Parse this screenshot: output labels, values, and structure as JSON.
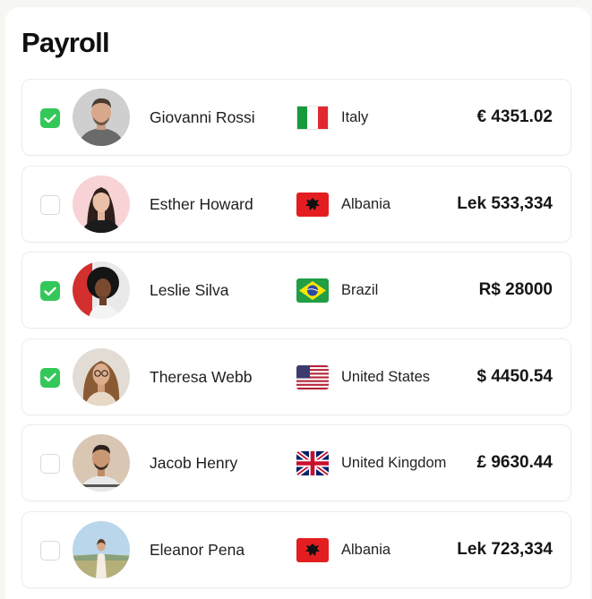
{
  "title": "Payroll",
  "colors": {
    "accent_check": "#34c759",
    "card_border": "#ececec",
    "page_background": "#f6f6f3"
  },
  "employees": [
    {
      "name": "Giovanni Rossi",
      "country": "Italy",
      "flag": "italy-flag-icon",
      "amount": "€ 4351.02",
      "checked": true
    },
    {
      "name": "Esther Howard",
      "country": "Albania",
      "flag": "albania-flag-icon",
      "amount": "Lek 533,334",
      "checked": false
    },
    {
      "name": "Leslie Silva",
      "country": "Brazil",
      "flag": "brazil-flag-icon",
      "amount": "R$ 28000",
      "checked": true
    },
    {
      "name": "Theresa Webb",
      "country": "United States",
      "flag": "usa-flag-icon",
      "amount": "$ 4450.54",
      "checked": true
    },
    {
      "name": "Jacob Henry",
      "country": "United Kingdom",
      "flag": "uk-flag-icon",
      "amount": "£ 9630.44",
      "checked": false
    },
    {
      "name": "Eleanor Pena",
      "country": "Albania",
      "flag": "albania-flag-icon",
      "amount": "Lek 723,334",
      "checked": false
    }
  ]
}
